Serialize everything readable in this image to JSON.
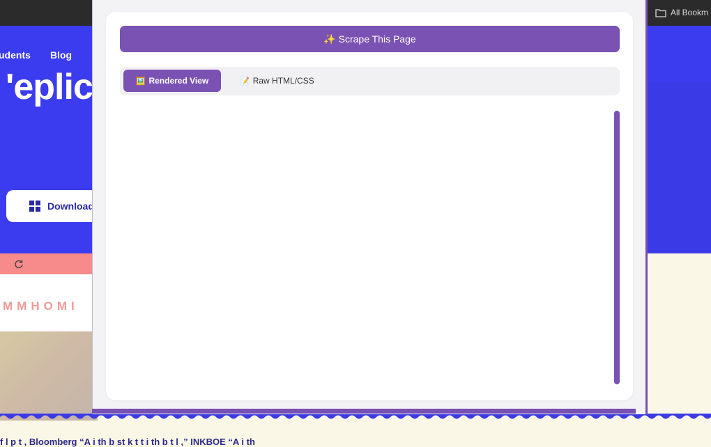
{
  "browser": {
    "bookmarks_label": "All Bookm",
    "folder_icon": "folder-icon"
  },
  "site": {
    "nav": [
      "udents",
      "Blog"
    ],
    "hero_title": "'eplic",
    "download_label": "Download",
    "marquee": "MMHOMI",
    "footer_quote": "f l  p        t     ,  Bloomberg      “A     i  th  b  st k       t         t i  th  b  t  l     ,” INKBOE      “A     i  th"
  },
  "popup": {
    "scrape_button_label": "✨ Scrape This Page",
    "tabs": [
      {
        "glyph": "🖼️",
        "label": "Rendered View"
      },
      {
        "glyph": "📝",
        "label": "Raw HTML/CSS"
      }
    ],
    "active_tab": "Rendered View"
  },
  "colors": {
    "accent": "#7a52b3",
    "hero_blue": "#3b3bf0",
    "salmon": "#f78b8b"
  }
}
